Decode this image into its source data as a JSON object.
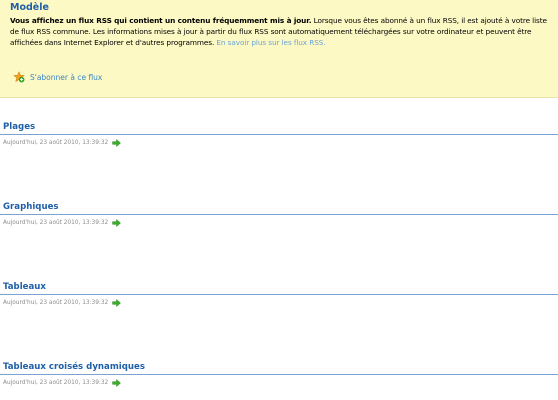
{
  "banner": {
    "title": "Modèle",
    "text_bold": "Vous affichez un flux RSS qui contient un contenu fréquemment mis à jour.",
    "text_body": " Lorsque vous êtes abonné à un flux RSS, il est ajouté à votre liste de flux RSS commune. Les informations mises à jour à partir du flux RSS sont automatiquement téléchargées sur votre ordinateur et peuvent être affichées dans Internet Explorer et d'autres programmes. ",
    "learn_more_link": "En savoir plus sur les flux RSS.",
    "subscribe_label": "S'abonner à ce flux",
    "subscribe_icon": "subscribe-star-icon"
  },
  "colors": {
    "banner_bg": "#fdf9c4",
    "title_blue": "#1f5fa8",
    "link_blue": "#6aa3d6",
    "rule_blue": "#7aa3d4",
    "arrow_green": "#3cae2c",
    "date_gray": "#8c8c8c"
  },
  "items": [
    {
      "title": "Plages",
      "date": "Aujourd'hui, 23 août 2010, 13:39:32",
      "icon": "green-arrow-icon"
    },
    {
      "title": "Graphiques",
      "date": "Aujourd'hui, 23 août 2010, 13:39:32",
      "icon": "green-arrow-icon"
    },
    {
      "title": "Tableaux",
      "date": "Aujourd'hui, 23 août 2010, 13:39:32",
      "icon": "green-arrow-icon"
    },
    {
      "title": "Tableaux croisés dynamiques",
      "date": "Aujourd'hui, 23 août 2010, 13:39:32",
      "icon": "green-arrow-icon"
    }
  ]
}
